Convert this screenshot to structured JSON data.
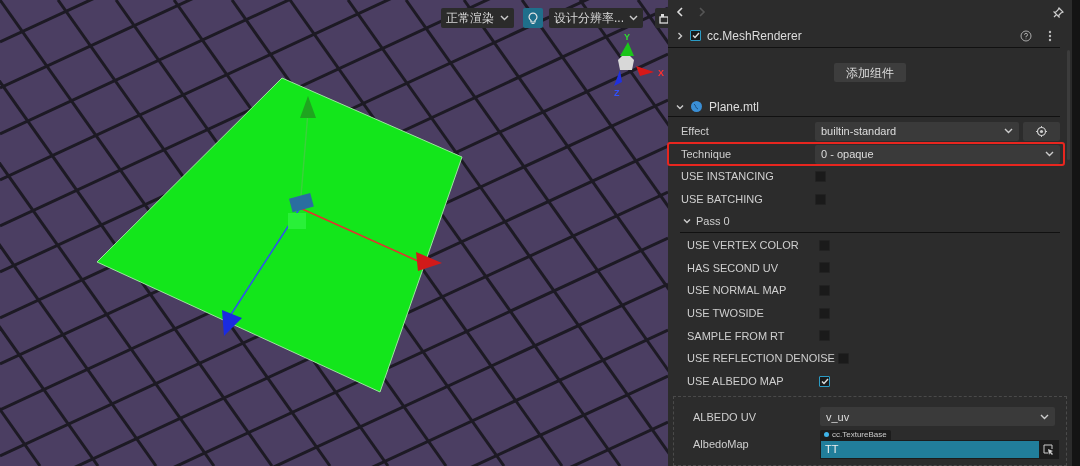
{
  "viewport": {
    "toolbar": {
      "render_mode": "正常渲染",
      "lighting_on": true,
      "resolution": "设计分辨率..."
    },
    "axis_labels": [
      "Y",
      "X",
      "Z"
    ]
  },
  "inspector": {
    "component": {
      "name": "cc.MeshRenderer",
      "enabled": true,
      "expanded": false
    },
    "add_component_button": "添加组件",
    "material": {
      "name": "Plane.mtl",
      "expanded": true
    },
    "properties": [
      {
        "kind": "selectlocate",
        "label": "Effect",
        "value": "builtin-standard",
        "highlighted": false
      },
      {
        "kind": "select",
        "label": "Technique",
        "value": "0 - opaque",
        "highlighted": true
      },
      {
        "kind": "checkbox",
        "label": "USE INSTANCING",
        "checked": false
      },
      {
        "kind": "checkbox",
        "label": "USE BATCHING",
        "checked": false
      }
    ],
    "pass": {
      "title": "Pass 0",
      "expanded": true,
      "properties": [
        {
          "kind": "checkbox",
          "label": "USE VERTEX COLOR",
          "checked": false
        },
        {
          "kind": "checkbox",
          "label": "HAS SECOND UV",
          "checked": false
        },
        {
          "kind": "checkbox",
          "label": "USE NORMAL MAP",
          "checked": false
        },
        {
          "kind": "checkbox",
          "label": "USE TWOSIDE",
          "checked": false
        },
        {
          "kind": "checkbox",
          "label": "SAMPLE FROM RT",
          "checked": false
        },
        {
          "kind": "checkbox",
          "label": "USE REFLECTION DENOISE",
          "checked": false
        },
        {
          "kind": "checkbox",
          "label": "USE ALBEDO MAP",
          "checked": true
        }
      ],
      "albedo_rows": [
        {
          "kind": "select",
          "label": "ALBEDO UV",
          "value": "v_uv"
        },
        {
          "kind": "asset",
          "label": "AlbedoMap",
          "type_tag": "cc.TextureBase",
          "value": "TT"
        }
      ]
    }
  }
}
